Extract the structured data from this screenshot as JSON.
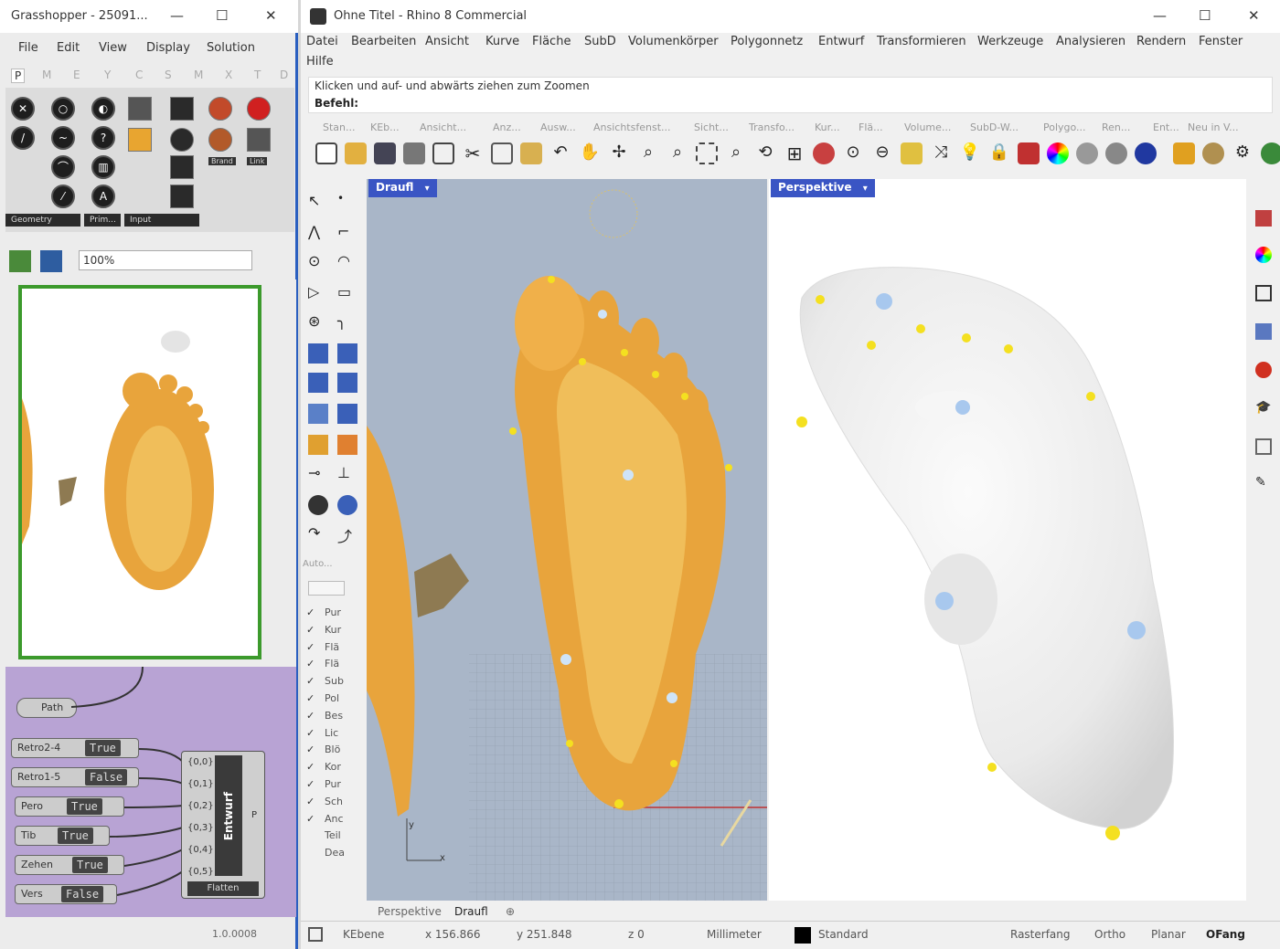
{
  "grasshopper": {
    "title": "Grasshopper - 25091...",
    "menu": [
      "File",
      "Edit",
      "View",
      "Display",
      "Solution"
    ],
    "tabs": [
      "P",
      "M",
      "E",
      "Y",
      "C",
      "S",
      "M",
      "X",
      "T",
      "D"
    ],
    "groups": [
      "Geometry",
      "Prim...",
      "Input"
    ],
    "ribbon_labels": [
      "Brand",
      "Link"
    ],
    "zoom": "100%",
    "path_label": "Path",
    "params": [
      {
        "name": "Retro2-4",
        "value": "True"
      },
      {
        "name": "Retro1-5",
        "value": "False"
      },
      {
        "name": "Pero",
        "value": "True"
      },
      {
        "name": "Tib",
        "value": "True"
      },
      {
        "name": "Zehen",
        "value": "True"
      },
      {
        "name": "Vers",
        "value": "False"
      }
    ],
    "entwurf": {
      "label": "Entwurf",
      "inputs": [
        "{0,0}",
        "{0,1}",
        "{0,2}",
        "{0,3}",
        "{0,4}",
        "{0,5}"
      ],
      "output": "P",
      "footer": "Flatten"
    },
    "version": "1.0.0008"
  },
  "rhino": {
    "title": "Ohne Titel - Rhino 8 Commercial",
    "menu_row1": [
      "Datei",
      "Bearbeiten",
      "Ansicht",
      "Kurve",
      "Fläche",
      "SubD",
      "Volumenkörper",
      "Polygonnetz",
      "Entwurf",
      "Transformieren",
      "Werkzeuge",
      "Analysieren",
      "Rendern",
      "Fenster"
    ],
    "menu_row2": [
      "Hilfe"
    ],
    "command_history": "Klicken und auf- und abwärts ziehen zum Zoomen",
    "command_prompt": "Befehl:",
    "toolbar_tabs": [
      "Stan...",
      "KEb...",
      "Ansicht...",
      "Anz...",
      "Ausw...",
      "Ansichtsfenst...",
      "Sicht...",
      "Transfo...",
      "Kur...",
      "Flä...",
      "Volume...",
      "SubD-W...",
      "Polygo...",
      "Ren...",
      "Ent...",
      "Neu in V..."
    ],
    "viewport_top": "Draufl",
    "viewport_persp": "Perspektive",
    "axis_y": "y",
    "axis_x": "x",
    "layers_header": "Auto...",
    "layers": [
      {
        "label": "Pur",
        "checked": true
      },
      {
        "label": "Kur",
        "checked": true
      },
      {
        "label": "Flä",
        "checked": true
      },
      {
        "label": "Flä",
        "checked": true
      },
      {
        "label": "Sub",
        "checked": true
      },
      {
        "label": "Pol",
        "checked": true
      },
      {
        "label": "Bes",
        "checked": true
      },
      {
        "label": "Lic",
        "checked": true
      },
      {
        "label": "Blö",
        "checked": true
      },
      {
        "label": "Kor",
        "checked": true
      },
      {
        "label": "Pur",
        "checked": true
      },
      {
        "label": "Sch",
        "checked": true
      },
      {
        "label": "Anc",
        "checked": true
      },
      {
        "label": "Teil",
        "checked": false
      },
      {
        "label": "Dea",
        "checked": false
      }
    ],
    "viewport_tabs": [
      "Perspektive",
      "Draufl"
    ],
    "status": {
      "layer": "KEbene",
      "x": "x 156.866",
      "y": "y 251.848",
      "z": "z 0",
      "unit": "Millimeter",
      "layer_name": "Standard",
      "grid_snap": "Rasterfang",
      "ortho": "Ortho",
      "planar": "Planar",
      "osnap": "OFang"
    }
  },
  "colors": {
    "foot": "#e8a43c",
    "selection_blue": "#3a55c4",
    "gh_purple": "#b8a3d4",
    "gh_green": "#3c9a2c"
  }
}
